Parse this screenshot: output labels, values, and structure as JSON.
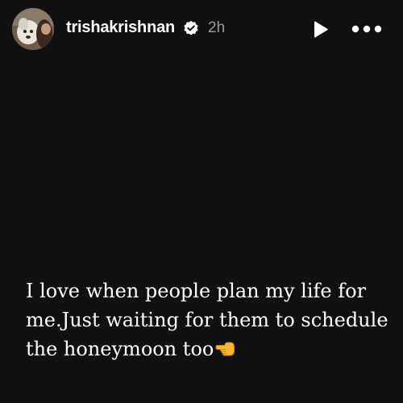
{
  "story": {
    "username": "trishakrishnan",
    "time_ago": "2h",
    "caption": "I love when people plan my life for me.Just waiting for them to schedule the honeymoon too",
    "caption_emoji": "backhand-index-pointing-left-emoji"
  },
  "icons": {
    "verified": "verified-badge-icon",
    "play": "play-icon",
    "more": "more-options-icon"
  },
  "colors": {
    "background": "#111111",
    "text": "#ffffff",
    "timestamp": "#9a9a9a"
  }
}
